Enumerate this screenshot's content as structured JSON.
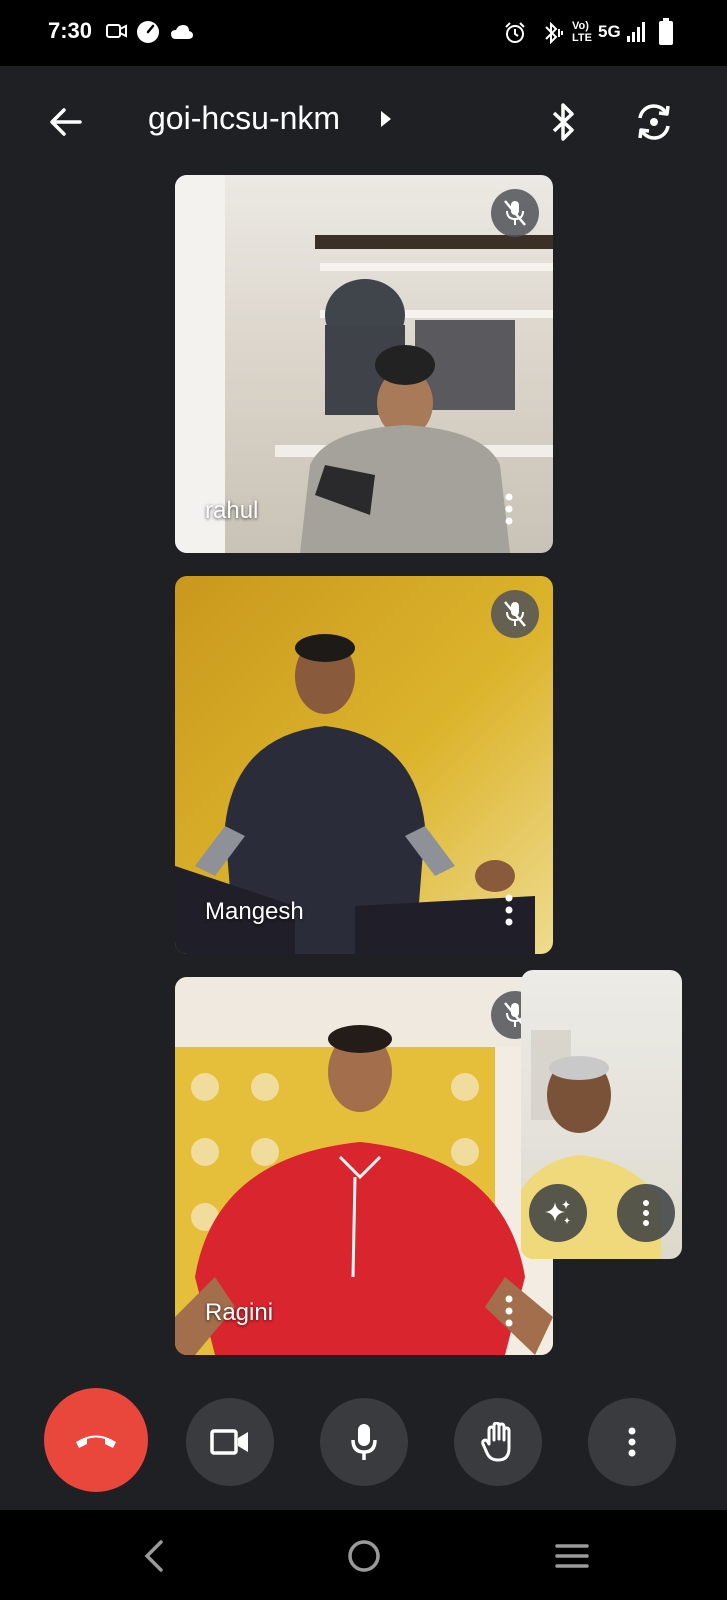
{
  "status_bar": {
    "time": "7:30",
    "left_icons": [
      "video-call-icon",
      "speedometer-icon",
      "cloud-icon"
    ],
    "right_icons": [
      "alarm-icon",
      "bluetooth-vibrate-icon",
      "volte-icon",
      "5g-icon",
      "signal-icon",
      "battery-icon"
    ],
    "network_label": "5G",
    "volte_label": "Vo) LTE"
  },
  "header": {
    "meeting_code": "goi-hcsu-nkm",
    "icons": [
      "back-arrow-icon",
      "caret-right-icon",
      "bluetooth-icon",
      "switch-camera-icon"
    ]
  },
  "participants": [
    {
      "name": "rahul",
      "muted": true,
      "bg": "#d9d4cc"
    },
    {
      "name": "Mangesh",
      "muted": true,
      "bg": "#d4a821"
    },
    {
      "name": "Ragini",
      "muted": true,
      "bg": "#e7c23c"
    }
  ],
  "self_view": {
    "buttons": [
      "sparkle-effects-icon",
      "more-vert-icon"
    ]
  },
  "controls": {
    "end_call_color": "#e9473b",
    "buttons": [
      "end-call-icon",
      "camera-icon",
      "microphone-icon",
      "raise-hand-icon",
      "more-vert-icon"
    ]
  },
  "nav_bar": {
    "items": [
      "back-icon",
      "home-icon",
      "recents-icon"
    ]
  }
}
